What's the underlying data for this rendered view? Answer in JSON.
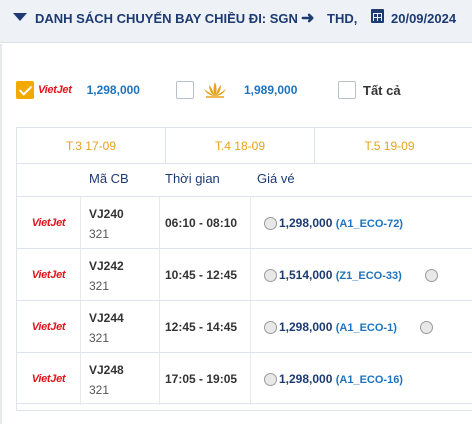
{
  "header": {
    "title": "DANH SÁCH CHUYẾN BAY CHIỀU ĐI: SGN",
    "destination": "THD,",
    "date": "20/09/2024"
  },
  "filters": [
    {
      "airline": "Vietjet",
      "logo_text": "VietJet",
      "price": "1,298,000",
      "checked": true
    },
    {
      "airline": "Vietnam Airlines",
      "logo_icon": "lotus-icon",
      "price": "1,989,000",
      "checked": false
    },
    {
      "label": "Tất cả",
      "checked": false
    }
  ],
  "date_tabs": [
    "T.3 17-09",
    "T.4 18-09",
    "T.5 19-09"
  ],
  "columns": [
    "Mã CB",
    "Thời gian",
    "Giá vé"
  ],
  "flights": [
    {
      "logo": "VietJet",
      "code": "VJ240",
      "aircraft": "321",
      "time": "06:10 - 08:10",
      "price": "1,298,000",
      "fare_class": "(A1_ECO-72)"
    },
    {
      "logo": "VietJet",
      "code": "VJ242",
      "aircraft": "321",
      "time": "10:45 - 12:45",
      "price": "1,514,000",
      "fare_class": "(Z1_ECO-33)"
    },
    {
      "logo": "VietJet",
      "code": "VJ244",
      "aircraft": "321",
      "time": "12:45 - 14:45",
      "price": "1,298,000",
      "fare_class": "(A1_ECO-1)"
    },
    {
      "logo": "VietJet",
      "code": "VJ248",
      "aircraft": "321",
      "time": "17:05 - 19:05",
      "price": "1,298,000",
      "fare_class": "(A1_ECO-16)"
    }
  ],
  "colors": {
    "header_text": "#1d3b72",
    "tab_text": "#e6a21b",
    "price_blue": "#1e73be",
    "vietjet_red": "#e2161b",
    "checkbox_checked": "#f2a900"
  }
}
